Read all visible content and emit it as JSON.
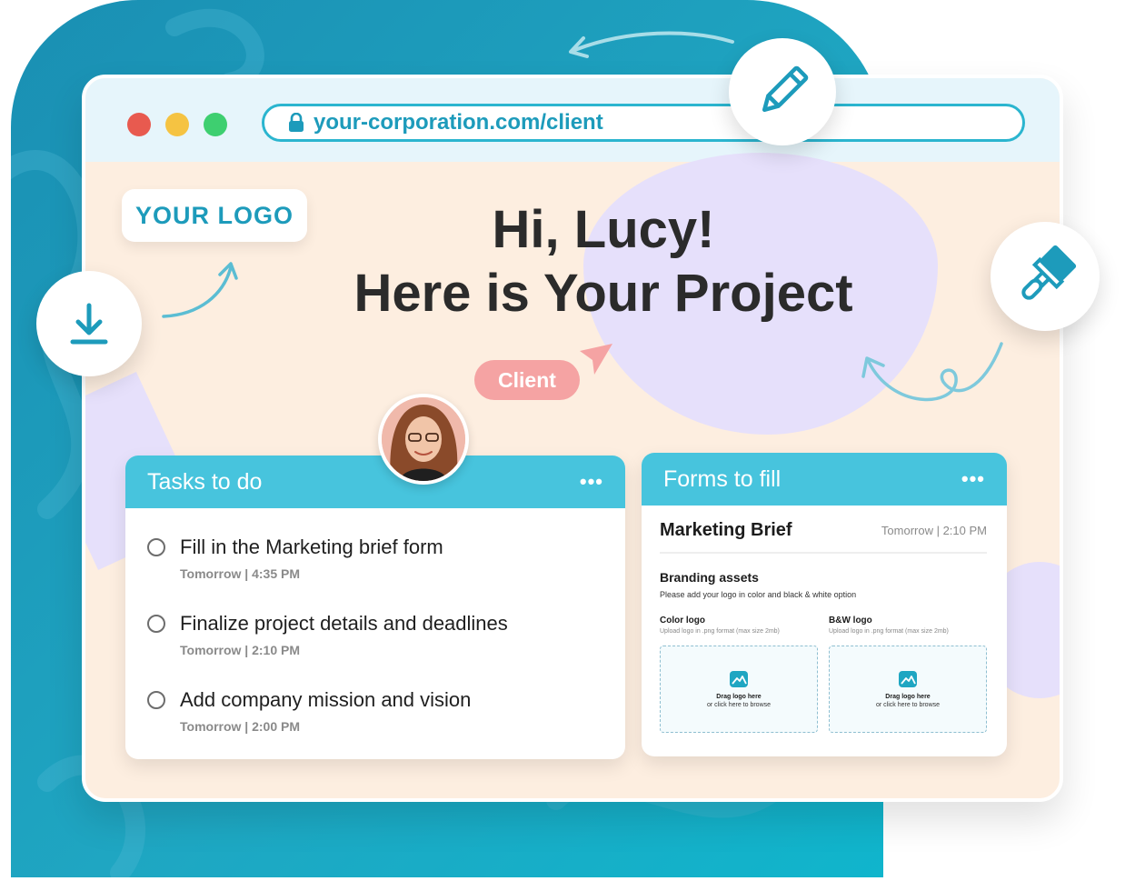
{
  "browser": {
    "url": "your-corporation.com/client"
  },
  "hero": {
    "logo_label": "YOUR LOGO",
    "line1": "Hi, Lucy!",
    "line2": "Here is Your Project",
    "client_badge": "Client"
  },
  "tasks": {
    "title": "Tasks to do",
    "more": "•••",
    "items": [
      {
        "text": "Fill in the Marketing brief form",
        "time": "Tomorrow | 4:35 PM"
      },
      {
        "text": "Finalize project details and deadlines",
        "time": "Tomorrow | 2:10 PM"
      },
      {
        "text": "Add company mission and vision",
        "time": "Tomorrow | 2:00 PM"
      }
    ]
  },
  "forms": {
    "title": "Forms to fill",
    "more": "•••",
    "form_title": "Marketing Brief",
    "form_due": "Tomorrow | 2:10 PM",
    "section_title": "Branding assets",
    "section_sub": "Please add your logo in color and black & white option",
    "uploads": [
      {
        "label": "Color logo",
        "hint": "Upload logo in .png format (max size 2mb)",
        "drop_title": "Drag logo here",
        "drop_sub": "or click here to browse"
      },
      {
        "label": "B&W logo",
        "hint": "Upload logo in .png format (max size 2mb)",
        "drop_title": "Drag logo here",
        "drop_sub": "or click here to browse"
      }
    ]
  },
  "icons": {
    "lock": "lock-icon",
    "download": "download-icon",
    "pencil": "pencil-icon",
    "paintbrush": "paintbrush-icon",
    "cursor": "cursor-arrow-icon",
    "image": "image-icon",
    "more": "more-dots-icon"
  },
  "colors": {
    "accent_teal": "#47c4dd",
    "url_teal": "#1d9bbb",
    "backdrop_teal": "#1fa6c2",
    "page_peach": "#fdeee0",
    "blob_lavender": "#e6e0fb",
    "client_pink": "#f5a3a3",
    "dot_red": "#e85a4f",
    "dot_yellow": "#f5c342",
    "dot_green": "#3ecf70"
  }
}
